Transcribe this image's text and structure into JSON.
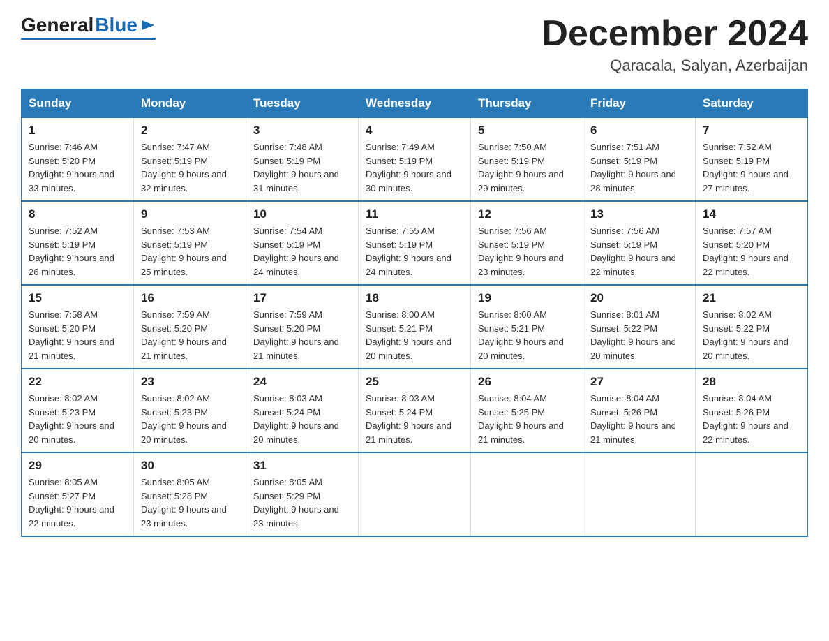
{
  "header": {
    "logo_general": "General",
    "logo_blue": "Blue",
    "month_title": "December 2024",
    "location": "Qaracala, Salyan, Azerbaijan"
  },
  "days_of_week": [
    "Sunday",
    "Monday",
    "Tuesday",
    "Wednesday",
    "Thursday",
    "Friday",
    "Saturday"
  ],
  "weeks": [
    [
      {
        "day": "1",
        "sunrise": "7:46 AM",
        "sunset": "5:20 PM",
        "daylight": "9 hours and 33 minutes."
      },
      {
        "day": "2",
        "sunrise": "7:47 AM",
        "sunset": "5:19 PM",
        "daylight": "9 hours and 32 minutes."
      },
      {
        "day": "3",
        "sunrise": "7:48 AM",
        "sunset": "5:19 PM",
        "daylight": "9 hours and 31 minutes."
      },
      {
        "day": "4",
        "sunrise": "7:49 AM",
        "sunset": "5:19 PM",
        "daylight": "9 hours and 30 minutes."
      },
      {
        "day": "5",
        "sunrise": "7:50 AM",
        "sunset": "5:19 PM",
        "daylight": "9 hours and 29 minutes."
      },
      {
        "day": "6",
        "sunrise": "7:51 AM",
        "sunset": "5:19 PM",
        "daylight": "9 hours and 28 minutes."
      },
      {
        "day": "7",
        "sunrise": "7:52 AM",
        "sunset": "5:19 PM",
        "daylight": "9 hours and 27 minutes."
      }
    ],
    [
      {
        "day": "8",
        "sunrise": "7:52 AM",
        "sunset": "5:19 PM",
        "daylight": "9 hours and 26 minutes."
      },
      {
        "day": "9",
        "sunrise": "7:53 AM",
        "sunset": "5:19 PM",
        "daylight": "9 hours and 25 minutes."
      },
      {
        "day": "10",
        "sunrise": "7:54 AM",
        "sunset": "5:19 PM",
        "daylight": "9 hours and 24 minutes."
      },
      {
        "day": "11",
        "sunrise": "7:55 AM",
        "sunset": "5:19 PM",
        "daylight": "9 hours and 24 minutes."
      },
      {
        "day": "12",
        "sunrise": "7:56 AM",
        "sunset": "5:19 PM",
        "daylight": "9 hours and 23 minutes."
      },
      {
        "day": "13",
        "sunrise": "7:56 AM",
        "sunset": "5:19 PM",
        "daylight": "9 hours and 22 minutes."
      },
      {
        "day": "14",
        "sunrise": "7:57 AM",
        "sunset": "5:20 PM",
        "daylight": "9 hours and 22 minutes."
      }
    ],
    [
      {
        "day": "15",
        "sunrise": "7:58 AM",
        "sunset": "5:20 PM",
        "daylight": "9 hours and 21 minutes."
      },
      {
        "day": "16",
        "sunrise": "7:59 AM",
        "sunset": "5:20 PM",
        "daylight": "9 hours and 21 minutes."
      },
      {
        "day": "17",
        "sunrise": "7:59 AM",
        "sunset": "5:20 PM",
        "daylight": "9 hours and 21 minutes."
      },
      {
        "day": "18",
        "sunrise": "8:00 AM",
        "sunset": "5:21 PM",
        "daylight": "9 hours and 20 minutes."
      },
      {
        "day": "19",
        "sunrise": "8:00 AM",
        "sunset": "5:21 PM",
        "daylight": "9 hours and 20 minutes."
      },
      {
        "day": "20",
        "sunrise": "8:01 AM",
        "sunset": "5:22 PM",
        "daylight": "9 hours and 20 minutes."
      },
      {
        "day": "21",
        "sunrise": "8:02 AM",
        "sunset": "5:22 PM",
        "daylight": "9 hours and 20 minutes."
      }
    ],
    [
      {
        "day": "22",
        "sunrise": "8:02 AM",
        "sunset": "5:23 PM",
        "daylight": "9 hours and 20 minutes."
      },
      {
        "day": "23",
        "sunrise": "8:02 AM",
        "sunset": "5:23 PM",
        "daylight": "9 hours and 20 minutes."
      },
      {
        "day": "24",
        "sunrise": "8:03 AM",
        "sunset": "5:24 PM",
        "daylight": "9 hours and 20 minutes."
      },
      {
        "day": "25",
        "sunrise": "8:03 AM",
        "sunset": "5:24 PM",
        "daylight": "9 hours and 21 minutes."
      },
      {
        "day": "26",
        "sunrise": "8:04 AM",
        "sunset": "5:25 PM",
        "daylight": "9 hours and 21 minutes."
      },
      {
        "day": "27",
        "sunrise": "8:04 AM",
        "sunset": "5:26 PM",
        "daylight": "9 hours and 21 minutes."
      },
      {
        "day": "28",
        "sunrise": "8:04 AM",
        "sunset": "5:26 PM",
        "daylight": "9 hours and 22 minutes."
      }
    ],
    [
      {
        "day": "29",
        "sunrise": "8:05 AM",
        "sunset": "5:27 PM",
        "daylight": "9 hours and 22 minutes."
      },
      {
        "day": "30",
        "sunrise": "8:05 AM",
        "sunset": "5:28 PM",
        "daylight": "9 hours and 23 minutes."
      },
      {
        "day": "31",
        "sunrise": "8:05 AM",
        "sunset": "5:29 PM",
        "daylight": "9 hours and 23 minutes."
      },
      null,
      null,
      null,
      null
    ]
  ]
}
